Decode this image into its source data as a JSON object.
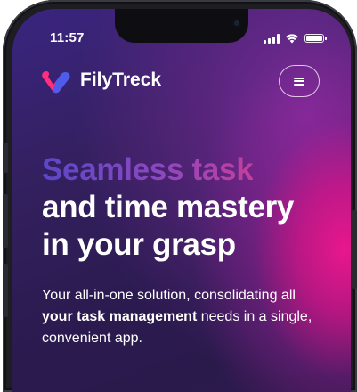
{
  "status_bar": {
    "time": "11:57",
    "icons": [
      "signal-icon",
      "wifi-icon",
      "battery-icon"
    ]
  },
  "header": {
    "brand": "FilyTreck",
    "logo": "filytreck-logo",
    "menu_icon": "hamburger-menu-icon"
  },
  "hero": {
    "headline_accent": "Seamless task",
    "headline_line2": "and time mastery",
    "headline_line3": "in your grasp",
    "desc_part1": "Your all-in-one solution, consolidating all",
    "desc_bold": "your task management",
    "desc_part2": " needs in a single,",
    "desc_part3": "convenient app."
  },
  "colors": {
    "accent": "#6d4fd1",
    "logo_pink": "#ff2e7e",
    "logo_blue": "#4f5bea",
    "background": "#2b1a4e",
    "glow": "#e8178c"
  }
}
